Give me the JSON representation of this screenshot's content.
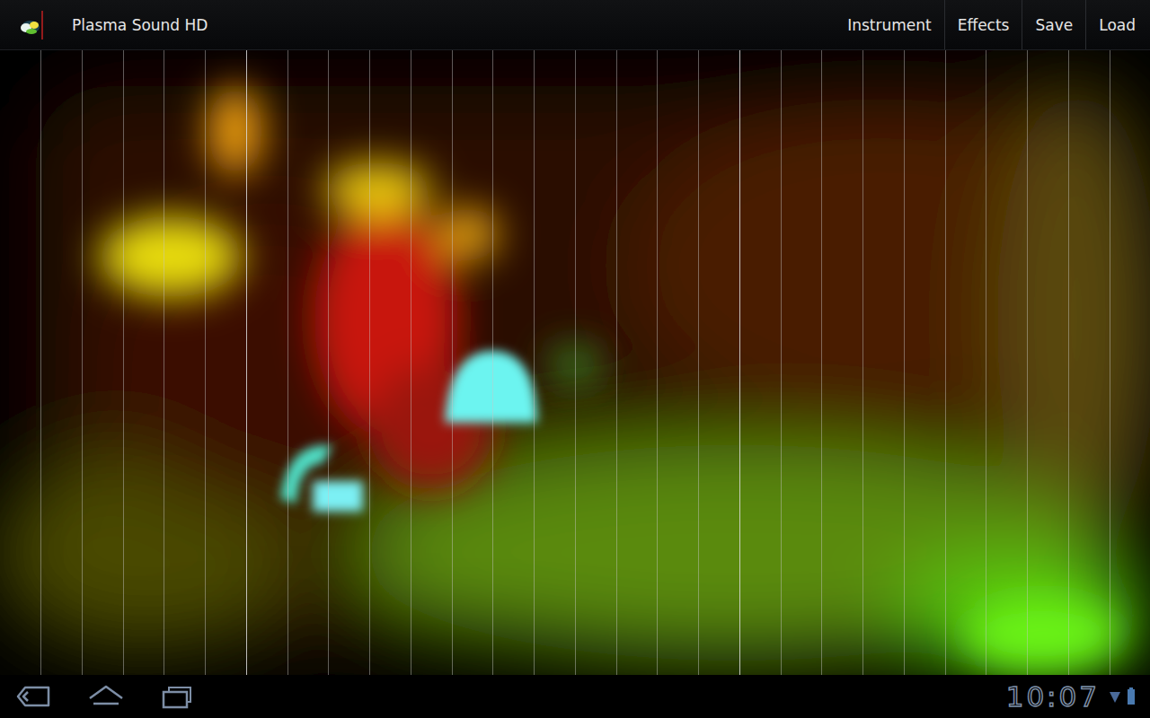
{
  "window": {
    "title": "Plasma Sound HD"
  },
  "menu": [
    {
      "label": "Instrument"
    },
    {
      "label": "Effects"
    },
    {
      "label": "Save"
    },
    {
      "label": "Load"
    }
  ],
  "system_bar": {
    "clock": "10:07"
  }
}
